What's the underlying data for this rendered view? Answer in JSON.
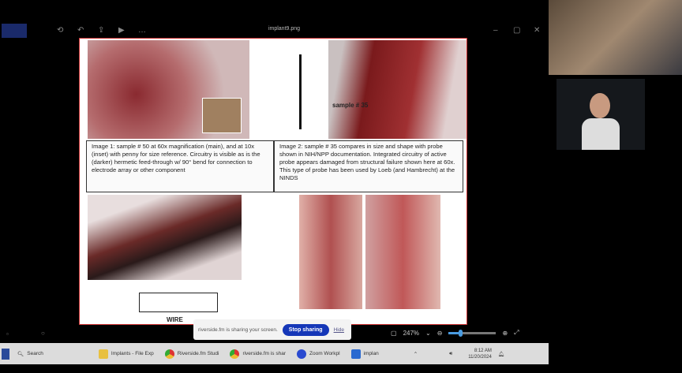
{
  "window": {
    "title": "implant9.png"
  },
  "document": {
    "caption1": "Image 1: sample # 50 at 60x magnification (main), and at 10x (inset) with penny for size reference. Circuitry is visible as is the (darker) hermetic feed-through w/ 90° bend for connection to electrode array or other component",
    "caption2": "Image 2: sample # 35 compares in size and shape with probe shown in NIH/NPP documentation. Integrated circuitry of active probe appears damaged from structural failure shown here at 60x. This type of probe has been used by Loeb (and Hambrecht) at the NINDS",
    "sample_label": "sample # 35",
    "wire_label": "WIRE"
  },
  "share_bar": {
    "message": "riverside.fm is sharing your screen.",
    "stop": "Stop sharing",
    "hide": "Hide"
  },
  "viewer": {
    "zoom": "247%",
    "zoom_fraction": 0.25
  },
  "taskbar": {
    "search": "Search",
    "items": [
      "Implants - File Exp",
      "Riverside.fm Studi",
      "riverside.fm is shar",
      "Zoom Workpl",
      "implan"
    ],
    "time": "8:12 AM",
    "date": "11/20/2024"
  }
}
